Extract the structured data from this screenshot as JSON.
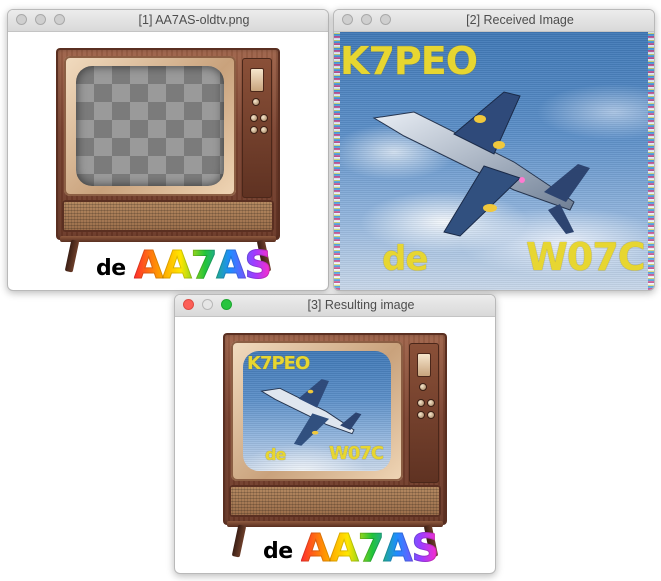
{
  "windows": {
    "w1": {
      "title": "[1] AA7AS-oldtv.png"
    },
    "w2": {
      "title": "[2] Received Image"
    },
    "w3": {
      "title": "[3] Resulting image"
    }
  },
  "overlay": {
    "de": "de",
    "callsign": "AA7AS"
  },
  "received": {
    "to_call": "K7PEO",
    "de": "de",
    "from_call": "W07C"
  },
  "colors": {
    "close": "#fc5f57",
    "minimize": "#e6e6e6",
    "zoom": "#29c440",
    "sstv_text": "#e7d631"
  }
}
